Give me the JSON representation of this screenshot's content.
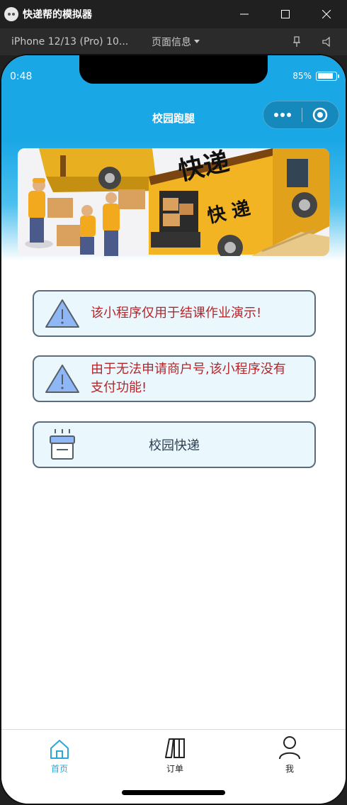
{
  "window": {
    "title": "快递帮的模拟器",
    "icon": "wechat-devtools-icon"
  },
  "toolbar": {
    "device": "iPhone 12/13 (Pro) 10...",
    "page_info": "页面信息"
  },
  "status_bar": {
    "time": "0:48",
    "battery": "85%"
  },
  "nav": {
    "title": "校园跑腿"
  },
  "banner": {
    "sign_text_large": "快递",
    "truck_text": "快 递"
  },
  "cards": [
    {
      "icon": "warning-icon",
      "text": "该小程序仅用于结课作业演示!"
    },
    {
      "icon": "warning-icon",
      "text_line1": "由于无法申请商户号,该小程序没有",
      "text_line2": "支付功能!"
    },
    {
      "icon": "package-box-icon",
      "text": "校园快递"
    }
  ],
  "tabs": [
    {
      "label": "首页",
      "icon": "home-icon",
      "active": true
    },
    {
      "label": "订单",
      "icon": "orders-icon",
      "active": false
    },
    {
      "label": "我",
      "icon": "user-icon",
      "active": false
    }
  ],
  "colors": {
    "header_blue": "#1aa7e6",
    "warning_text": "#b5262a",
    "card_bg": "#eaf8fe",
    "tab_active": "#2aa8d8"
  }
}
